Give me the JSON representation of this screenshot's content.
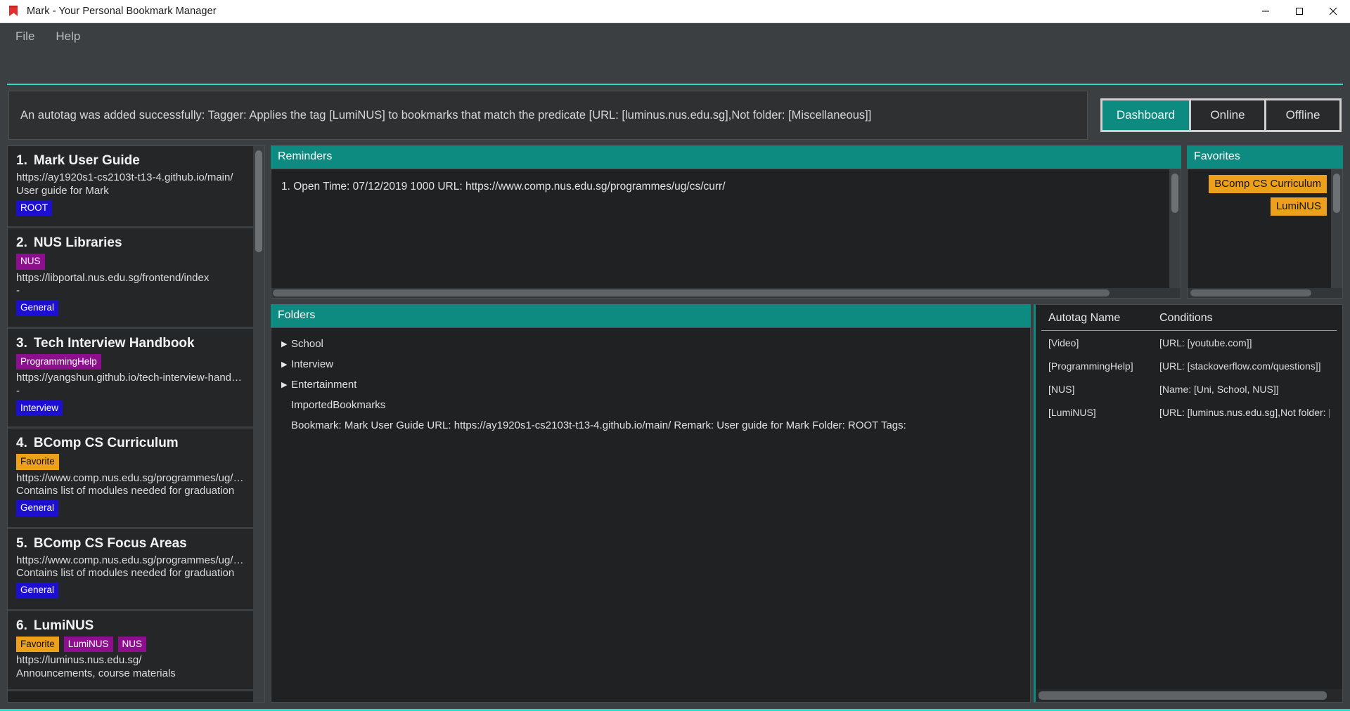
{
  "window": {
    "title": "Mark - Your Personal Bookmark Manager",
    "minimize": "—",
    "maximize": "☐",
    "close": "✕"
  },
  "menubar": {
    "items": [
      {
        "label": "File"
      },
      {
        "label": "Help"
      }
    ]
  },
  "notification": {
    "message": "An autotag was added successfully: Tagger: Applies the tag [LumiNUS] to bookmarks that match the predicate [URL: [luminus.nus.edu.sg],Not folder: [Miscellaneous]]"
  },
  "tabs": [
    {
      "label": "Dashboard",
      "active": true
    },
    {
      "label": "Online",
      "active": false
    },
    {
      "label": "Offline",
      "active": false
    }
  ],
  "bookmarks": [
    {
      "index": "1.",
      "title": "Mark User Guide",
      "tags_top": [],
      "url": "https://ay1920s1-cs2103t-t13-4.github.io/main/",
      "remark": "User guide for Mark",
      "tags_bottom": [
        {
          "label": "ROOT",
          "color": "blue"
        }
      ]
    },
    {
      "index": "2.",
      "title": "NUS Libraries",
      "tags_top": [
        {
          "label": "NUS",
          "color": "purple"
        }
      ],
      "url": "https://libportal.nus.edu.sg/frontend/index",
      "remark": "-",
      "tags_bottom": [
        {
          "label": "General",
          "color": "blue"
        }
      ]
    },
    {
      "index": "3.",
      "title": "Tech Interview Handbook",
      "tags_top": [
        {
          "label": "ProgrammingHelp",
          "color": "purple"
        }
      ],
      "url": "https://yangshun.github.io/tech-interview-hand…",
      "remark": "-",
      "tags_bottom": [
        {
          "label": "Interview",
          "color": "blue"
        }
      ]
    },
    {
      "index": "4.",
      "title": "BComp CS Curriculum",
      "tags_top": [
        {
          "label": "Favorite",
          "color": "orange"
        }
      ],
      "url": "https://www.comp.nus.edu.sg/programmes/ug/…",
      "remark": "Contains list of modules needed for graduation",
      "tags_bottom": [
        {
          "label": "General",
          "color": "blue"
        }
      ]
    },
    {
      "index": "5.",
      "title": "BComp CS Focus Areas",
      "tags_top": [],
      "url": "https://www.comp.nus.edu.sg/programmes/ug/…",
      "remark": "Contains list of modules needed for graduation",
      "tags_bottom": [
        {
          "label": "General",
          "color": "blue"
        }
      ]
    },
    {
      "index": "6.",
      "title": "LumiNUS",
      "tags_top": [
        {
          "label": "Favorite",
          "color": "orange"
        },
        {
          "label": "LumiNUS",
          "color": "purple"
        },
        {
          "label": "NUS",
          "color": "purple"
        }
      ],
      "url": "https://luminus.nus.edu.sg/",
      "remark": "Announcements, course materials",
      "tags_bottom": []
    }
  ],
  "reminders": {
    "header": "Reminders",
    "items": [
      "1. Open Time: 07/12/2019 1000 URL: https://www.comp.nus.edu.sg/programmes/ug/cs/curr/"
    ]
  },
  "favorites": {
    "header": "Favorites",
    "items": [
      "BComp CS Curriculum",
      "LumiNUS"
    ]
  },
  "folders": {
    "header": "Folders",
    "rows": [
      {
        "label": "School",
        "expandable": true
      },
      {
        "label": "Interview",
        "expandable": true
      },
      {
        "label": "Entertainment",
        "expandable": true
      },
      {
        "label": "ImportedBookmarks",
        "expandable": false
      },
      {
        "label": "Bookmark: Mark User Guide URL: https://ay1920s1-cs2103t-t13-4.github.io/main/ Remark: User guide for Mark Folder: ROOT Tags:",
        "expandable": false
      }
    ]
  },
  "autotags": {
    "columns": [
      "Autotag Name",
      "Conditions"
    ],
    "rows": [
      {
        "name": "[Video]",
        "conditions": "[URL: [youtube.com]]"
      },
      {
        "name": "[ProgrammingHelp]",
        "conditions": "[URL: [stackoverflow.com/questions]]"
      },
      {
        "name": "[NUS]",
        "conditions": "[Name: [Uni, School, NUS]]"
      },
      {
        "name": "[LumiNUS]",
        "conditions": "[URL: [luminus.nus.edu.sg],Not folder: [Miscel."
      }
    ]
  },
  "colors": {
    "accent_teal": "#0d8b80",
    "rule_teal": "#2fd9c6",
    "tag_blue": "#1c0fd0",
    "tag_purple": "#8d0f8d",
    "tag_orange": "#eda11a",
    "app_bg": "#3c3f41",
    "panel_bg": "#1f2123"
  }
}
